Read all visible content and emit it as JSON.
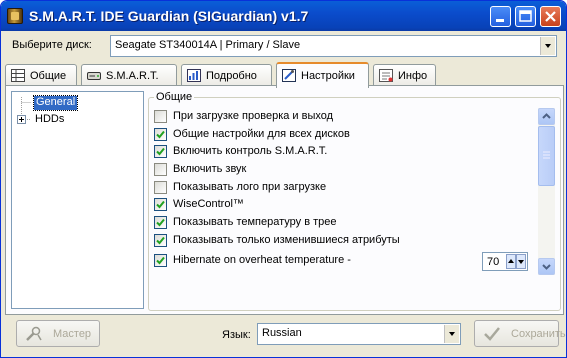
{
  "window": {
    "title": "S.M.A.R.T. IDE Guardian (SIGuardian) v1.7",
    "controls": [
      "minimize-icon",
      "maximize-icon",
      "close-icon"
    ]
  },
  "disk": {
    "label": "Выберите диск:",
    "value": "Seagate ST340014A  |  Primary / Slave"
  },
  "tabs": [
    {
      "label": "Общие",
      "icon": "grid-icon"
    },
    {
      "label": "S.M.A.R.T.",
      "icon": "drive-icon"
    },
    {
      "label": "Подробно",
      "icon": "chart-icon"
    },
    {
      "label": "Настройки",
      "icon": "settings-icon",
      "active": true
    },
    {
      "label": "Инфо",
      "icon": "info-icon"
    }
  ],
  "tree": {
    "items": [
      {
        "label": "General",
        "selected": true
      },
      {
        "label": "HDDs",
        "expandable": true
      }
    ]
  },
  "settings": {
    "group_title": "Общие",
    "options": [
      {
        "label": "При загрузке проверка и выход",
        "checked": false
      },
      {
        "label": "Общие настройки для всех дисков",
        "checked": true
      },
      {
        "label": "Включить контроль S.M.A.R.T.",
        "checked": true
      },
      {
        "label": "Включить звук",
        "checked": false
      },
      {
        "label": "Показывать лого при загрузке",
        "checked": false
      },
      {
        "label": "WiseControl™",
        "checked": true
      },
      {
        "label": "Показывать температуру в трее",
        "checked": true
      },
      {
        "label": "Показывать только изменившиеся атрибуты",
        "checked": true
      },
      {
        "label": "Hibernate on overheat temperature -",
        "checked": true
      }
    ],
    "temperature_value": "70"
  },
  "footer": {
    "wizard_label": "Мастер",
    "language_label": "Язык:",
    "language_value": "Russian",
    "save_label": "Сохранить"
  },
  "colors": {
    "titlebar": "#0a4fd0",
    "active_tab_accent": "#e68b2c",
    "window_face": "#ece9d8",
    "close_button": "#d9532a",
    "disabled_text": "#aca899"
  }
}
